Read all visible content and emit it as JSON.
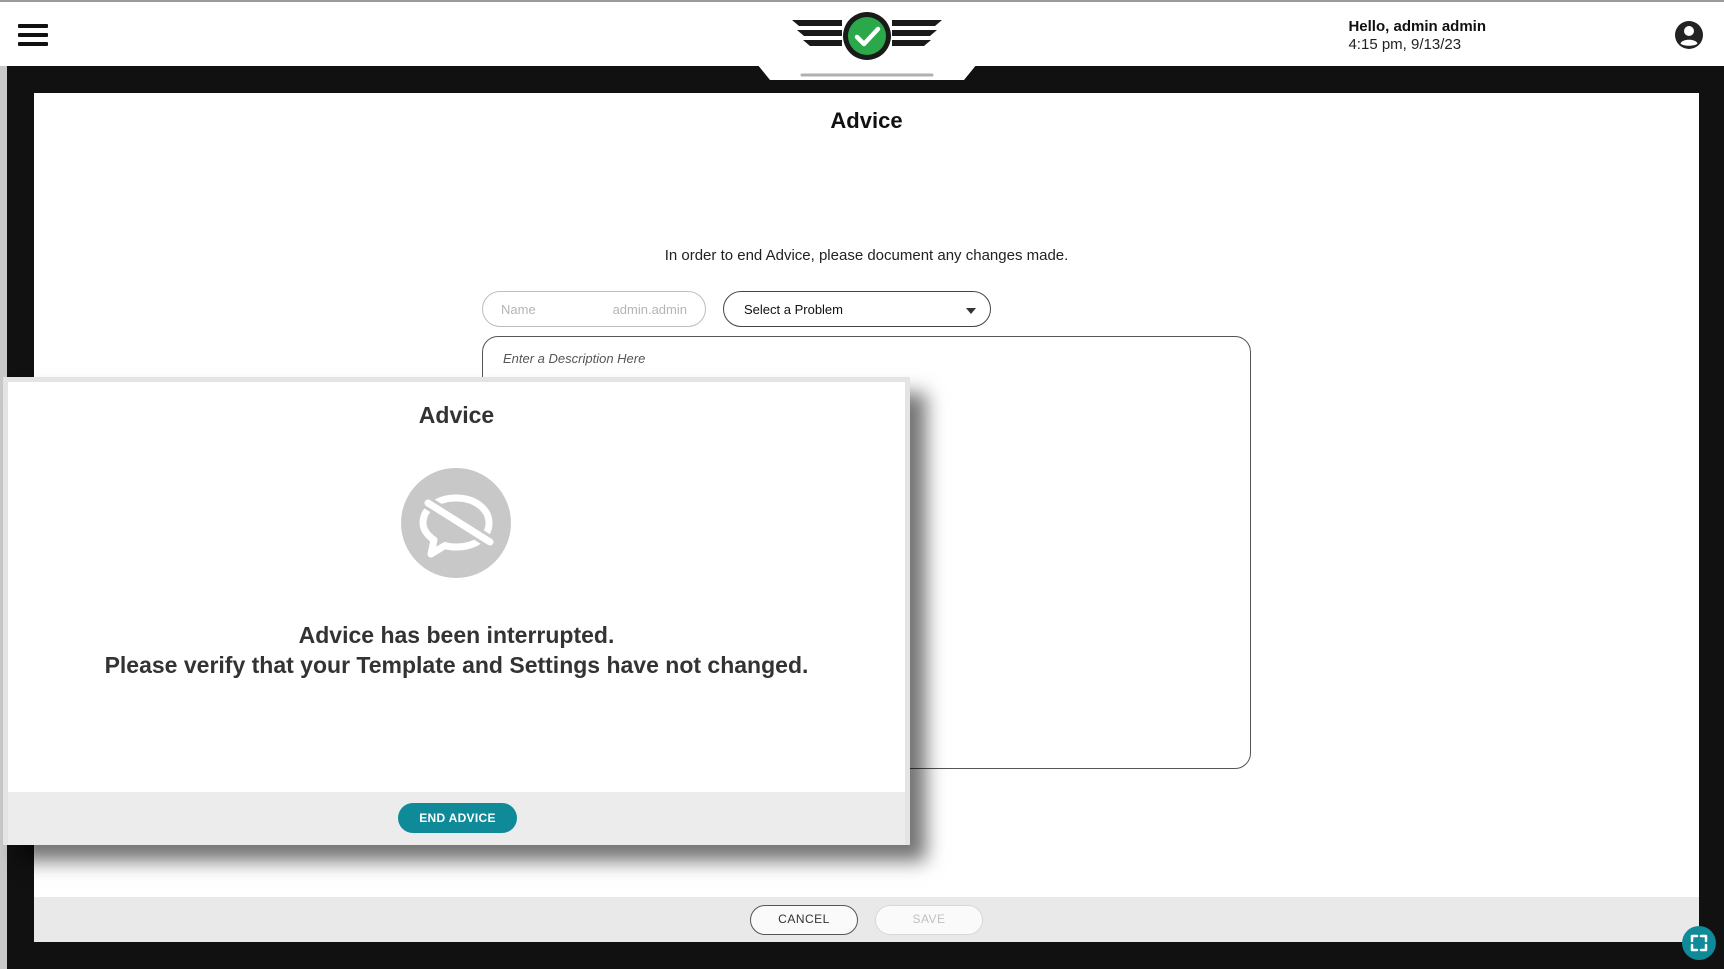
{
  "header": {
    "greeting": "Hello, admin admin",
    "timestamp": "4:15 pm, 9/13/23"
  },
  "page": {
    "title": "Advice",
    "instruction": "In order to end Advice, please document any changes made.",
    "name_field": {
      "label": "Name",
      "value": "admin.admin"
    },
    "problem_select": {
      "selected": "Select a Problem"
    },
    "description": {
      "placeholder": "Enter a Description Here"
    },
    "footer": {
      "cancel_label": "CANCEL",
      "save_label": "SAVE"
    }
  },
  "modal": {
    "title": "Advice",
    "icon": "chat-off-icon",
    "message_line1": "Advice has been interrupted.",
    "message_line2": "Please verify that your Template and Settings have not changed.",
    "end_button_label": "END ADVICE"
  },
  "colors": {
    "accent": "#0e8a99",
    "logo_check": "#2aa84a",
    "frame": "#111111"
  }
}
